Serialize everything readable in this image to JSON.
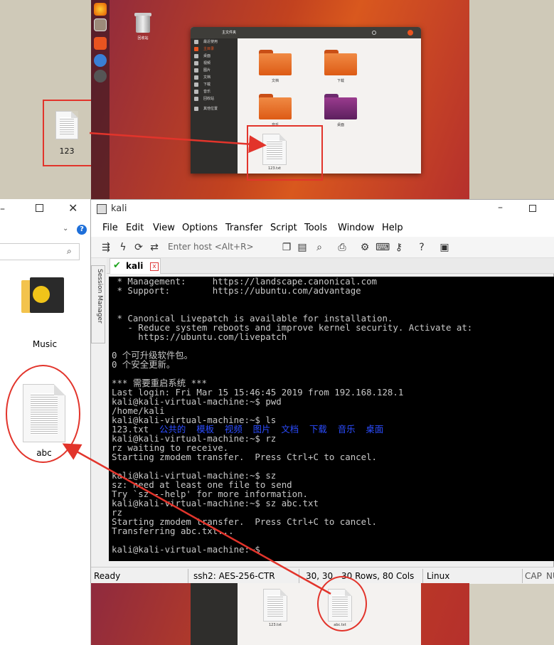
{
  "desktop": {
    "file_123": {
      "label": "123"
    },
    "trash_label": "回收站",
    "folders": [
      {
        "label": "文档"
      },
      {
        "label": "下载"
      },
      {
        "label": "音乐"
      },
      {
        "label": "桌面"
      }
    ],
    "copied_file": {
      "label": "123.txt"
    },
    "fm_title": "主文件夹",
    "sidebar": [
      "最近使用",
      "主目录",
      "桌面",
      "视频",
      "图片",
      "文档",
      "下载",
      "音乐",
      "回收站",
      "其他位置"
    ]
  },
  "explorer": {
    "music_label": "Music",
    "abc_label": "abc"
  },
  "xshell": {
    "title": "kali",
    "menu": [
      "File",
      "Edit",
      "View",
      "Options",
      "Transfer",
      "Script",
      "Tools",
      "Window",
      "Help"
    ],
    "host_placeholder": "Enter host <Alt+R>",
    "session_manager": "Session Manager",
    "tab_label": "kali",
    "terminal": {
      "l1": " * Management:     https://landscape.canonical.com",
      "l2": " * Support:        https://ubuntu.com/advantage",
      "l3": "",
      "l4": "",
      "l5": " * Canonical Livepatch is available for installation.",
      "l6": "   - Reduce system reboots and improve kernel security. Activate at:",
      "l7": "     https://ubuntu.com/livepatch",
      "l8": "",
      "l9": "0 个可升级软件包。",
      "l10": "0 个安全更新。",
      "l11": "",
      "l12": "*** 需要重启系统 ***",
      "l13": "Last login: Fri Mar 15 15:46:45 2019 from 192.168.128.1",
      "l14": "kali@kali-virtual-machine:~$ pwd",
      "l15": "/home/kali",
      "l16": "kali@kali-virtual-machine:~$ ls",
      "l17a": "123.txt",
      "l17b": "  公共的  模板  视频  图片  文档  下载  音乐  桌面",
      "l18": "kali@kali-virtual-machine:~$ rz",
      "l19": "rz waiting to receive.",
      "l20": "Starting zmodem transfer.  Press Ctrl+C to cancel.",
      "l21": "",
      "l22": "kali@kali-virtual-machine:~$ sz",
      "l23": "sz: need at least one file to send",
      "l24": "Try `sz --help' for more information.",
      "l25": "kali@kali-virtual-machine:~$ sz abc.txt",
      "l26": "rz",
      "l27": "Starting zmodem transfer.  Press Ctrl+C to cancel.",
      "l28": "Transferring abc.txt...",
      "l29": "",
      "l30": "kali@kali-virtual-machine:~$"
    },
    "status": {
      "ready": "Ready",
      "cipher": "ssh2: AES-256-CTR",
      "pos": "30,  30",
      "size": "30 Rows, 80 Cols",
      "os": "Linux",
      "cap": "CAP",
      "num": "NU"
    }
  },
  "bottom_fm": {
    "file1": "123.txt",
    "file2": "abc.txt"
  },
  "colors": {
    "annotation_red": "#e2342b",
    "terminal_bg": "#000000",
    "ls_dir_blue": "#2b4cff"
  }
}
